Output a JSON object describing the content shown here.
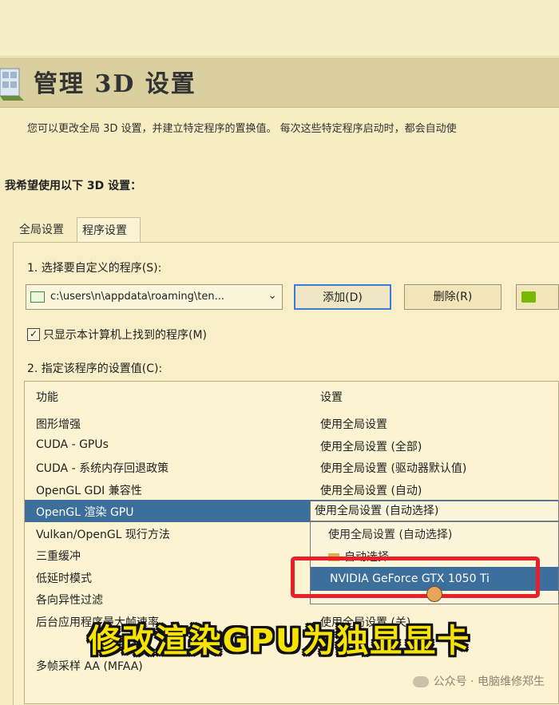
{
  "header": {
    "title": "管理 3D 设置"
  },
  "description": "您可以更改全局 3D 设置，并建立特定程序的置换值。 每次这些特定程序启动时，都会自动使",
  "section_label": "我希望使用以下 3D 设置：",
  "tabs": [
    {
      "label": "全局设置",
      "active": false
    },
    {
      "label": "程序设置",
      "active": true
    }
  ],
  "program_settings": {
    "step1": "1. 选择要自定义的程序(S):",
    "program_path": "c:\\users\\n\\appdata\\roaming\\ten...",
    "add_button": "添加(D)",
    "delete_button": "删除(R)",
    "checkbox_label": "只显示本计算机上找到的程序(M)",
    "checkbox_checked": true,
    "step2": "2. 指定该程序的设置值(C):"
  },
  "table": {
    "columns": [
      "功能",
      "设置"
    ],
    "rows": [
      {
        "feature": "图形增强",
        "value": "使用全局设置"
      },
      {
        "feature": "CUDA - GPUs",
        "value": "使用全局设置 (全部)"
      },
      {
        "feature": "CUDA - 系统内存回退政策",
        "value": "使用全局设置 (驱动器默认值)"
      },
      {
        "feature": "OpenGL GDI 兼容性",
        "value": "使用全局设置 (自动)"
      },
      {
        "feature": "OpenGL 渲染 GPU",
        "value": "",
        "selected": true
      },
      {
        "feature": "Vulkan/OpenGL 现行方法",
        "value": ""
      },
      {
        "feature": "三重缓冲",
        "value": ""
      },
      {
        "feature": "低延时模式",
        "value": ""
      },
      {
        "feature": "各向异性过滤",
        "value": ""
      },
      {
        "feature": "后台应用程序最大帧速率",
        "value": "使用全局设置 (关)"
      },
      {
        "feature": "",
        "value": ""
      },
      {
        "feature": "多帧采样 AA (MFAA)",
        "value": ""
      }
    ]
  },
  "dropdown": {
    "current": "使用全局设置 (自动选择)",
    "options": [
      {
        "label": "使用全局设置 (自动选择)",
        "selected": false
      },
      {
        "label": "自动选择",
        "selected": false
      },
      {
        "label": "NVIDIA GeForce GTX 1050 Ti",
        "selected": true
      }
    ]
  },
  "caption": "修改渲染GPU为独显显卡",
  "watermark": "公众号 · 电脑维修郑生",
  "colors": {
    "background": "#f7edc2",
    "selection": "#3c6f9c",
    "highlight_box": "#e8202a",
    "caption_text": "#f7e300",
    "nvidia": "#76b900"
  }
}
